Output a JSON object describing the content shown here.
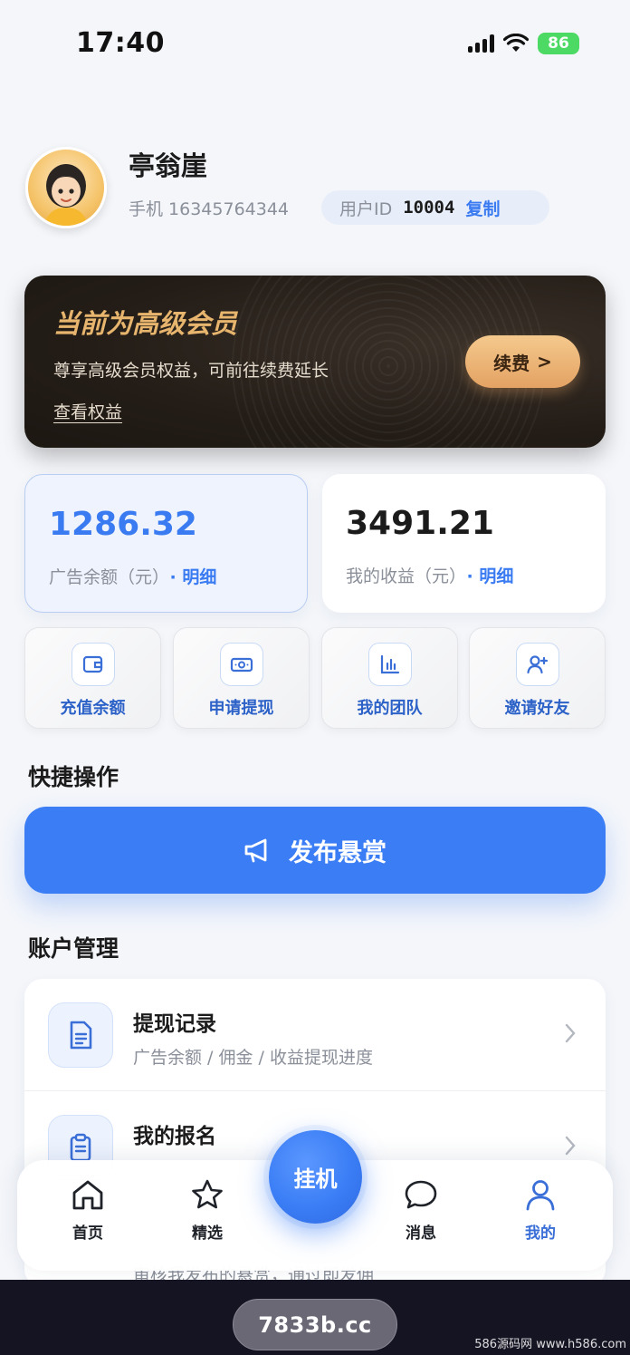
{
  "status_bar": {
    "time": "17:40",
    "battery": "86"
  },
  "profile": {
    "name": "亭翁崖",
    "phone_label": "手机 16345764344",
    "uid_label": "用户ID",
    "uid_value": "10004",
    "copy_label": "复制"
  },
  "vip": {
    "title": "当前为高级会员",
    "description": "尊享高级会员权益，可前往续费延长",
    "link": "查看权益",
    "renew_label": "续费",
    "renew_arrow": ">"
  },
  "balances": {
    "ad_balance": {
      "value": "1286.32",
      "label": "广告余额（元）",
      "detail": "· 明细"
    },
    "earnings": {
      "value": "3491.21",
      "label": "我的收益（元）",
      "detail": "· 明细"
    }
  },
  "quick_grid": [
    {
      "label": "充值余额",
      "icon": "wallet-icon"
    },
    {
      "label": "申请提现",
      "icon": "cash-icon"
    },
    {
      "label": "我的团队",
      "icon": "bar-chart-icon"
    },
    {
      "label": "邀请好友",
      "icon": "add-user-icon"
    }
  ],
  "quick_actions": {
    "title": "快捷操作",
    "publish_label": "发布悬赏"
  },
  "account": {
    "title": "账户管理",
    "items": [
      {
        "title": "提现记录",
        "subtitle": "广告余额 / 佣金 / 收益提现进度",
        "icon": "document-icon"
      },
      {
        "title": "我的报名",
        "subtitle": "",
        "icon": "clipboard-icon"
      }
    ],
    "peek_text": "审核我发布的悬赏，通过即发佣"
  },
  "tabbar": {
    "items": [
      {
        "label": "首页",
        "icon": "home-icon"
      },
      {
        "label": "精选",
        "icon": "star-icon"
      },
      {
        "label": "消息",
        "icon": "message-icon"
      },
      {
        "label": "我的",
        "icon": "user-icon",
        "active": true
      }
    ],
    "fab_label": "挂机"
  },
  "footer": {
    "domain": "7833b.cc",
    "watermark": "586源码网 www.h586.com"
  },
  "colors": {
    "accent": "#3a7df5",
    "gold": "#e8b56e",
    "vip_bg": "#241d17",
    "footer_bg": "#151422"
  }
}
